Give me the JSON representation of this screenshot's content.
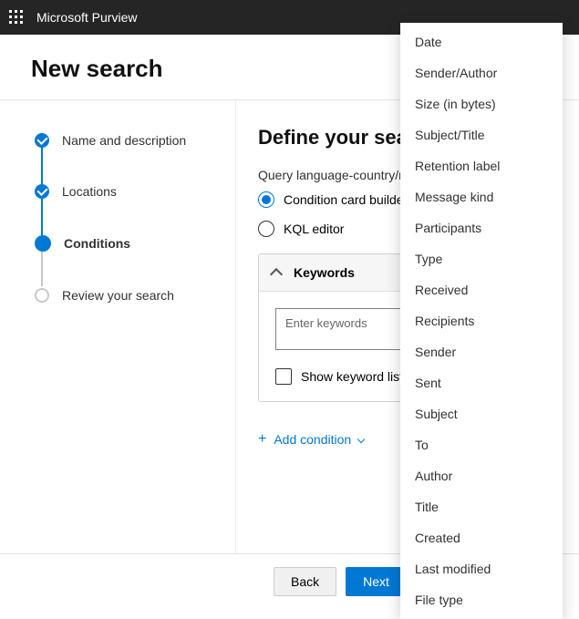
{
  "suite": {
    "title": "Microsoft Purview"
  },
  "page": {
    "title": "New search"
  },
  "stepper": {
    "items": [
      {
        "label": "Name and description",
        "state": "done"
      },
      {
        "label": "Locations",
        "state": "done"
      },
      {
        "label": "Conditions",
        "state": "current"
      },
      {
        "label": "Review your search",
        "state": "upcoming"
      }
    ]
  },
  "main": {
    "heading": "Define your search conditions",
    "query_label": "Query language-country/region",
    "builder_options": {
      "card": "Condition card builder",
      "kql": "KQL editor",
      "selected": "card"
    },
    "keywords_card": {
      "title": "Keywords",
      "placeholder": "Enter keywords",
      "value": "",
      "checkbox_label": "Show keyword list"
    },
    "add_condition_label": "Add condition"
  },
  "dropdown": {
    "items": [
      "Date",
      "Sender/Author",
      "Size (in bytes)",
      "Subject/Title",
      "Retention label",
      "Message kind",
      "Participants",
      "Type",
      "Received",
      "Recipients",
      "Sender",
      "Sent",
      "Subject",
      "To",
      "Author",
      "Title",
      "Created",
      "Last modified",
      "File type"
    ]
  },
  "footer": {
    "back": "Back",
    "next": "Next"
  }
}
